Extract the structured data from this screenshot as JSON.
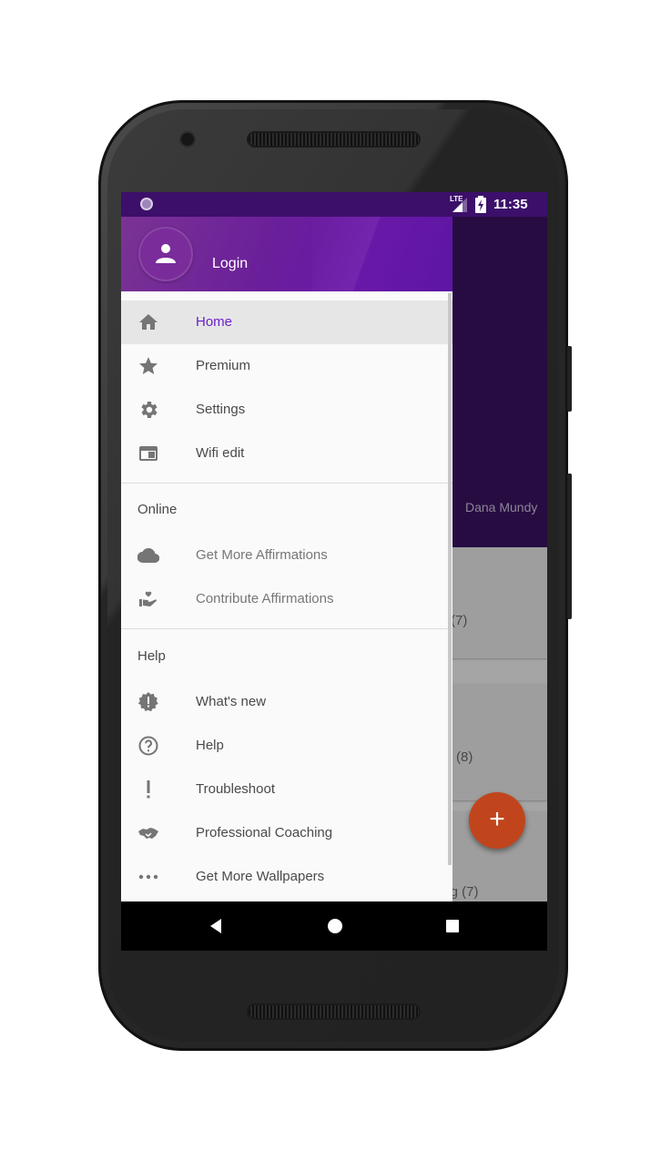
{
  "status_bar": {
    "time": "11:35",
    "network_label": "LTE",
    "icons": [
      "circle-notification-icon",
      "lte-signal-icon",
      "battery-charging-icon"
    ]
  },
  "background_app": {
    "author_name": "Dana Mundy",
    "card_counts": [
      "(7)",
      "(8)",
      "ing (7)"
    ],
    "fab_icon": "+",
    "accent_color": "#3a1262"
  },
  "drawer": {
    "header": {
      "login_label": "Login",
      "avatar_icon": "person-icon"
    },
    "items": [
      {
        "label": "Home",
        "icon": "home-icon",
        "active": true
      },
      {
        "label": "Premium",
        "icon": "star-icon"
      },
      {
        "label": "Settings",
        "icon": "gear-icon"
      },
      {
        "label": "Wifi edit",
        "icon": "wifi-edit-icon"
      }
    ],
    "sections": [
      {
        "title": "Online",
        "items": [
          {
            "label": "Get More Affirmations",
            "icon": "cloud-icon"
          },
          {
            "label": "Contribute Affirmations",
            "icon": "hand-heart-icon"
          }
        ]
      },
      {
        "title": "Help",
        "items": [
          {
            "label": "What's new",
            "icon": "new-badge-icon"
          },
          {
            "label": "Help",
            "icon": "help-circle-icon"
          },
          {
            "label": "Troubleshoot",
            "icon": "exclamation-icon"
          },
          {
            "label": "Professional Coaching",
            "icon": "handshake-icon"
          },
          {
            "label": "Get More Wallpapers",
            "icon": "more-dots-icon"
          }
        ]
      }
    ],
    "active_color": "#6a1fc9"
  },
  "nav_bar": {
    "buttons": [
      "back-icon",
      "home-circle-icon",
      "recents-square-icon"
    ]
  }
}
